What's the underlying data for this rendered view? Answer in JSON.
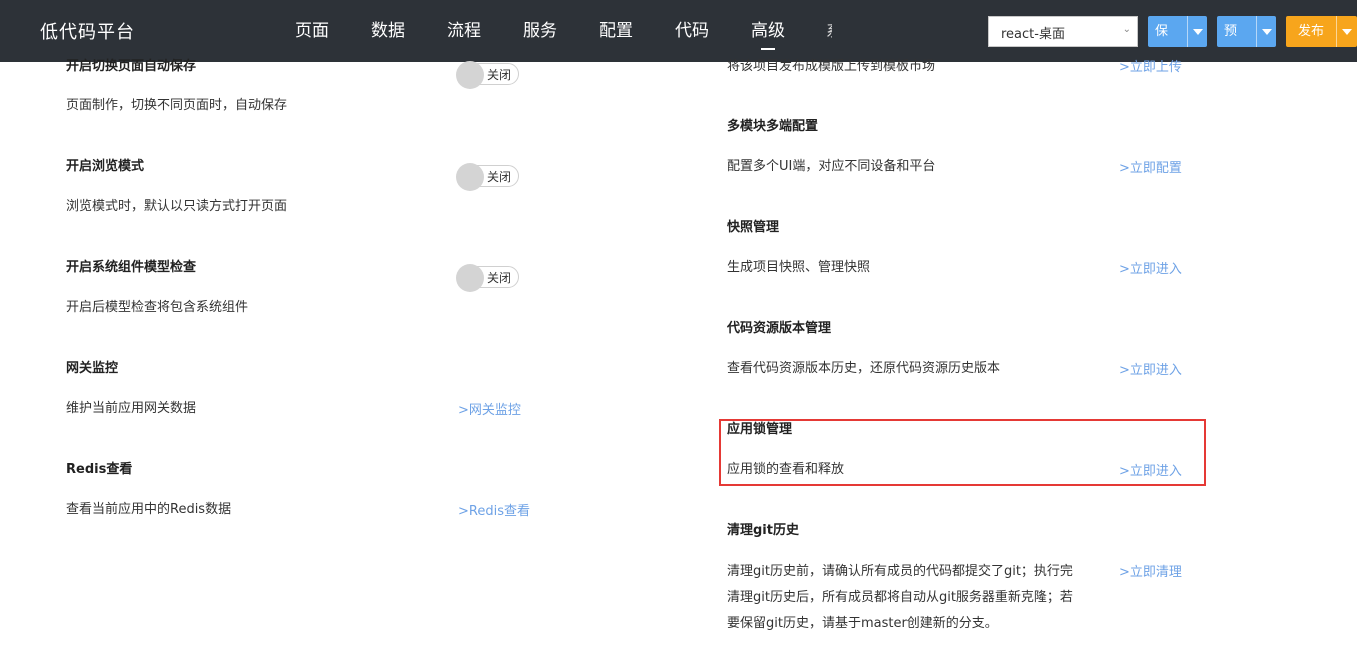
{
  "header": {
    "brand": "低代码平台",
    "nav": [
      "页面",
      "数据",
      "流程",
      "服务",
      "配置",
      "代码",
      "高级"
    ],
    "nav_active_index": 6,
    "nav_overflow_glyph": "系",
    "client_select": "react-桌面",
    "save_label": "保存",
    "preview_label": "预览",
    "publish_label": "发布"
  },
  "left_items": [
    {
      "title": "开启切换页面自动保存",
      "desc": "页面制作，切换不同页面时，自动保存",
      "toggle": "关闭"
    },
    {
      "title": "开启浏览模式",
      "desc": "浏览模式时，默认以只读方式打开页面",
      "toggle": "关闭"
    },
    {
      "title": "开启系统组件模型检查",
      "desc": "开启后模型检查将包含系统组件",
      "toggle": "关闭"
    },
    {
      "title": "网关监控",
      "desc": "维护当前应用网关数据",
      "link": ">网关监控"
    },
    {
      "title": "Redis查看",
      "desc": "查看当前应用中的Redis数据",
      "link": ">Redis查看"
    }
  ],
  "right_items": [
    {
      "title": "",
      "desc": "将该项目发布成模版上传到模板市场",
      "link": ">立即上传"
    },
    {
      "title": "多模块多端配置",
      "desc": "配置多个UI端，对应不同设备和平台",
      "link": ">立即配置"
    },
    {
      "title": "快照管理",
      "desc": "生成项目快照、管理快照",
      "link": ">立即进入"
    },
    {
      "title": "代码资源版本管理",
      "desc": "查看代码资源版本历史，还原代码资源历史版本",
      "link": ">立即进入"
    },
    {
      "title": "应用锁管理",
      "desc": "应用锁的查看和释放",
      "link": ">立即进入"
    },
    {
      "title": "清理git历史",
      "desc_lines": [
        "清理git历史前，请确认所有成员的代码都提交了git；执行完",
        "清理git历史后，所有成员都将自动从git服务器重新克隆；若",
        "要保留git历史，请基于master创建新的分支。"
      ],
      "link": ">立即清理"
    }
  ],
  "colors": {
    "header_bg": "#2d3238",
    "link": "#6ea2e6",
    "primary_btn": "#5ba7f0",
    "publish_btn": "#f7a51c",
    "highlight": "#e53935"
  }
}
